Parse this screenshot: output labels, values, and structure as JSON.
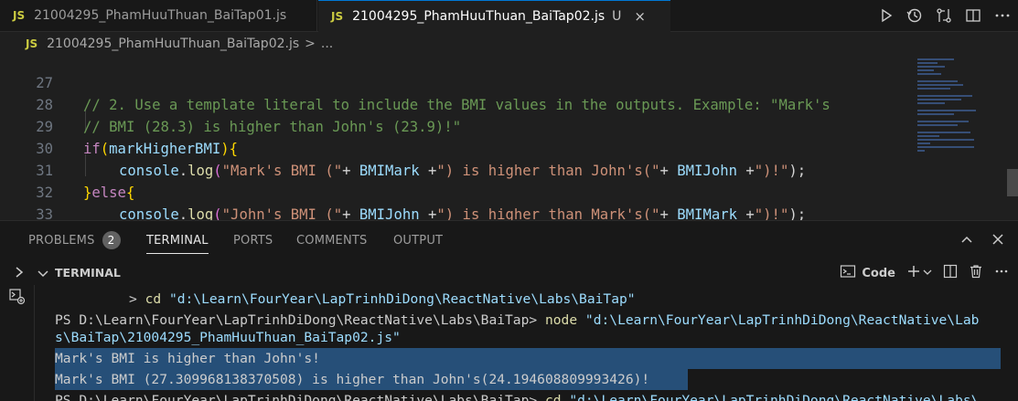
{
  "tabs": [
    {
      "lang": "JS",
      "label": "21004295_PhamHuuThuan_BaiTap01.js"
    },
    {
      "lang": "JS",
      "label": "21004295_PhamHuuThuan_BaiTap02.js",
      "flag": "U",
      "close": "×"
    }
  ],
  "editor_actions": [
    "run-icon",
    "history-icon",
    "compare-changes-icon",
    "split-editor-icon",
    "more-actions-icon"
  ],
  "breadcrumb": {
    "lang": "JS",
    "file": "21004295_PhamHuuThuan_BaiTap02.js",
    "sep": ">",
    "more": "..."
  },
  "code_lines": [
    {
      "n": "27",
      "text": "// 2. Use a template literal to include the BMI values in the outputs. Example: \"Mark's"
    },
    {
      "n": "28",
      "text": "// BMI (28.3) is higher than John's (23.9)!\""
    },
    {
      "n": "29",
      "kw": "if",
      "p1": "(",
      "var": "markHigherBMI",
      "p2": ")",
      "b": "{"
    },
    {
      "n": "30",
      "obj": "console",
      "dot": ".",
      "fn": "log",
      "s1": "\"Mark's BMI (\"",
      "op1": "+ ",
      "v1": "BMIMark",
      "op2": " +",
      "s2": "\") is higher than John's(\"",
      "op3": "+ ",
      "v2": "BMIJohn",
      "op4": " +",
      "s3": "\")!\"",
      "end": ");"
    },
    {
      "n": "31",
      "b1": "}",
      "kw": "else",
      "b2": "{"
    },
    {
      "n": "32",
      "obj": "console",
      "dot": ".",
      "fn": "log",
      "s1": "\"John's BMI (\"",
      "op1": "+ ",
      "v1": "BMIJohn",
      "op2": " +",
      "s2": "\") is higher than Mark's(\"",
      "op3": "+ ",
      "v2": "BMIMark",
      "op4": " +",
      "s3": "\")!\"",
      "end": ");"
    },
    {
      "n": "33",
      "b": "}"
    }
  ],
  "panel": {
    "tabs": [
      "PROBLEMS",
      "TERMINAL",
      "PORTS",
      "COMMENTS",
      "OUTPUT"
    ],
    "problems_count": "2",
    "active_tab": "TERMINAL",
    "terminal_title": "TERMINAL",
    "profile_label": "Code"
  },
  "terminal": {
    "line1_prefix": "> ",
    "line1_cmd": "cd",
    "line1_arg": "\"d:\\Learn\\FourYear\\LapTrinhDiDong\\ReactNative\\Labs\\BaiTap\"",
    "line2_prompt": "PS D:\\Learn\\FourYear\\LapTrinhDiDong\\ReactNative\\Labs\\BaiTap> ",
    "line2_cmd": "node",
    "line2_arg": "\"d:\\Learn\\FourYear\\LapTrinhDiDong\\ReactNative\\Lab",
    "line3_arg": "s\\BaiTap\\21004295_PhamHuuThuan_BaiTap02.js\"",
    "out1": "Mark's BMI is higher than John's!",
    "out2": "Mark's BMI (27.309968138370508) is higher than John's(24.194608809993426)!",
    "line6_prompt": "PS D:\\Learn\\FourYear\\LapTrinhDiDong\\ReactNative\\Labs\\BaiTap> ",
    "line6_cmd": "cd",
    "line6_arg": "\"d:\\Learn\\FourYear\\LapTrinhDiDong\\ReactNative\\Labs\\"
  }
}
